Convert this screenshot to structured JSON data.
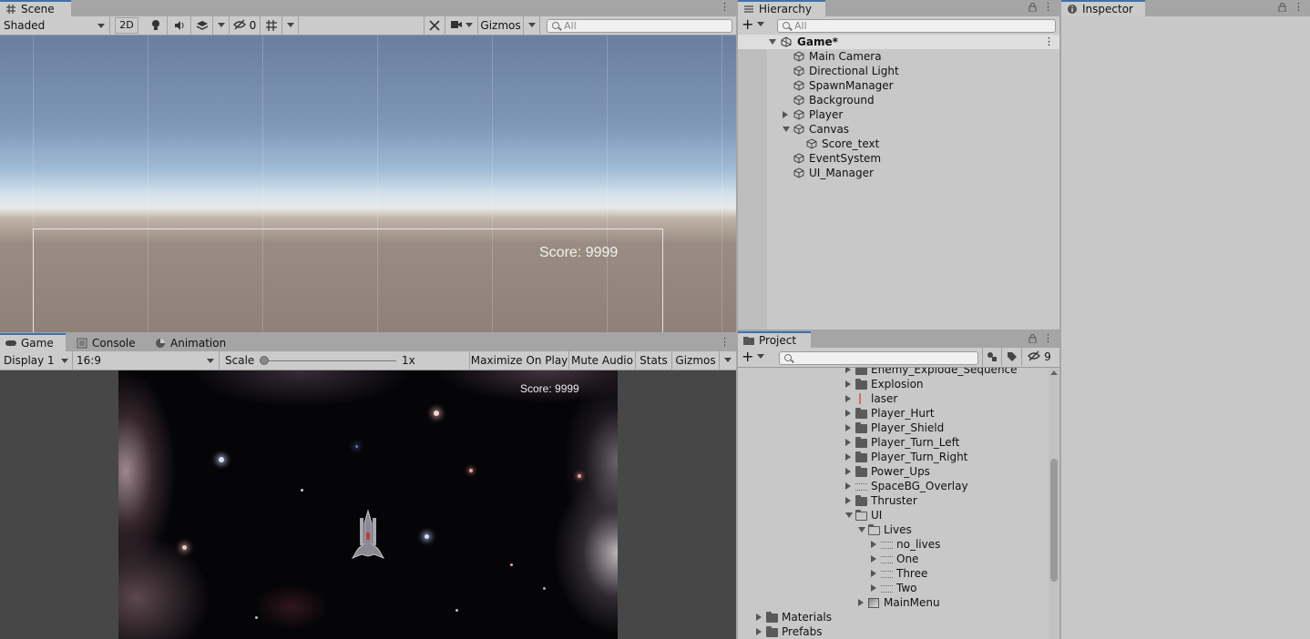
{
  "scene_panel": {
    "tab_label": "Scene",
    "shading_mode": "Shaded",
    "toggle_2d": "2D",
    "hidden_count": "0",
    "gizmos_label": "Gizmos",
    "search_placeholder": "All",
    "canvas_score_text": "Score: 9999"
  },
  "hierarchy_panel": {
    "tab_label": "Hierarchy",
    "search_placeholder": "All",
    "scene_name": "Game*",
    "items": [
      {
        "label": "Main Camera"
      },
      {
        "label": "Directional Light"
      },
      {
        "label": "SpawnManager"
      },
      {
        "label": "Background"
      },
      {
        "label": "Player"
      },
      {
        "label": "Canvas"
      },
      {
        "label": "Score_text"
      },
      {
        "label": "EventSystem"
      },
      {
        "label": "UI_Manager"
      }
    ]
  },
  "inspector_panel": {
    "tab_label": "Inspector"
  },
  "game_panel": {
    "tabs": [
      {
        "label": "Game"
      },
      {
        "label": "Console"
      },
      {
        "label": "Animation"
      }
    ],
    "display_select": "Display 1",
    "aspect_select": "16:9",
    "scale_label": "Scale",
    "scale_value": "1x",
    "maximize_on_play": "Maximize On Play",
    "mute_audio": "Mute Audio",
    "stats": "Stats",
    "gizmos_label": "Gizmos",
    "score_text": "Score: 9999"
  },
  "project_panel": {
    "tab_label": "Project",
    "hidden_packages_count": "9",
    "items": [
      {
        "label": "Enemy_Explode_Sequence"
      },
      {
        "label": "Explosion"
      },
      {
        "label": "laser"
      },
      {
        "label": "Player_Hurt"
      },
      {
        "label": "Player_Shield"
      },
      {
        "label": "Player_Turn_Left"
      },
      {
        "label": "Player_Turn_Right"
      },
      {
        "label": "Power_Ups"
      },
      {
        "label": "SpaceBG_Overlay"
      },
      {
        "label": "Thruster"
      },
      {
        "label": "UI"
      },
      {
        "label": "Lives"
      },
      {
        "label": "no_lives"
      },
      {
        "label": "One"
      },
      {
        "label": "Three"
      },
      {
        "label": "Two"
      },
      {
        "label": "MainMenu"
      },
      {
        "label": "Materials"
      },
      {
        "label": "Prefabs"
      }
    ]
  }
}
